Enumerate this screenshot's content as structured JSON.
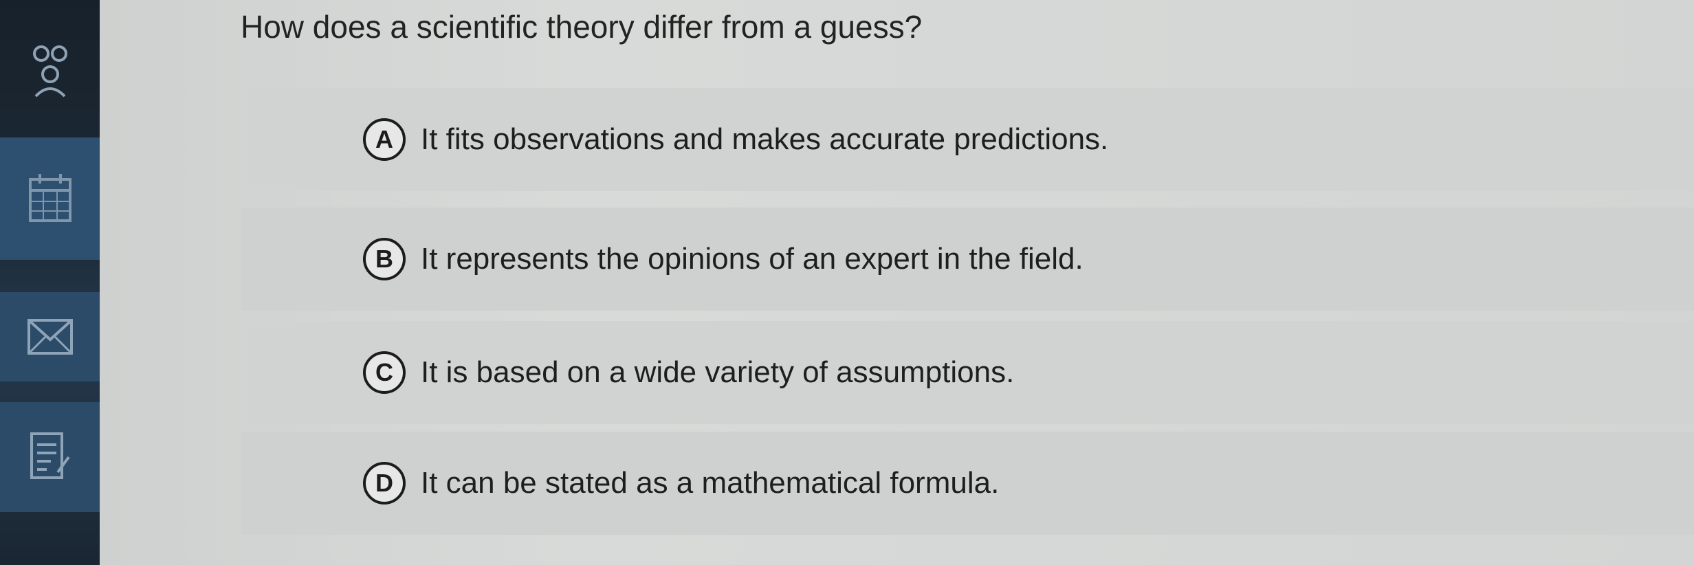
{
  "sidebar": {
    "items": [
      {
        "icon": "people-icon"
      },
      {
        "icon": "calendar-icon"
      },
      {
        "icon": "mail-icon"
      },
      {
        "icon": "notes-icon"
      }
    ]
  },
  "question": {
    "text": "How does a scientific theory differ from a guess?"
  },
  "options": [
    {
      "letter": "A",
      "text": "It fits observations and makes accurate predictions."
    },
    {
      "letter": "B",
      "text": "It represents the opinions of an expert in the field."
    },
    {
      "letter": "C",
      "text": "It is based on a wide variety of assumptions."
    },
    {
      "letter": "D",
      "text": "It can be stated as a mathematical formula."
    }
  ]
}
